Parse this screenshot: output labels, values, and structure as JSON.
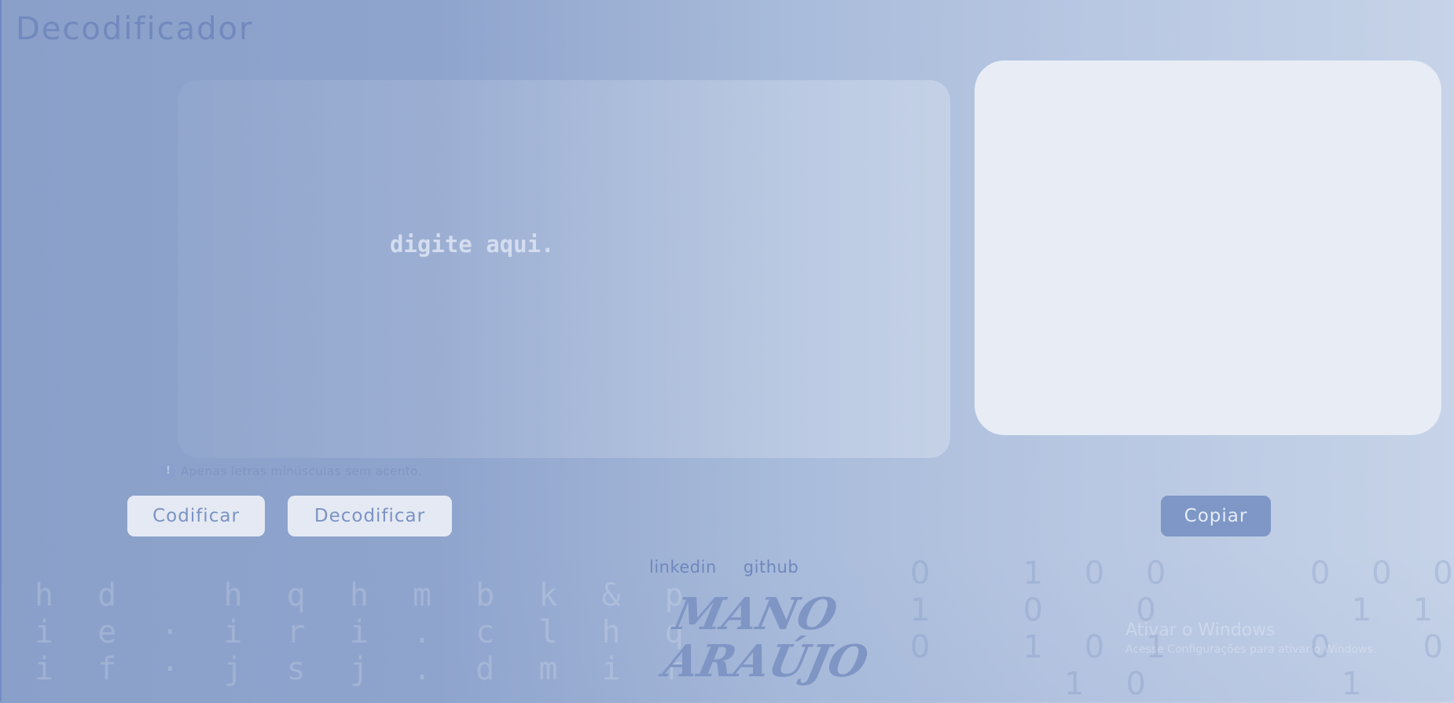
{
  "header": {
    "title": "Decodificador"
  },
  "input": {
    "placeholder": "digite aqui."
  },
  "hint": {
    "icon": "info-icon",
    "text": "Apenas letras minúsculas sem acento."
  },
  "buttons": {
    "encode": "Codificar",
    "decode": "Decodificar",
    "copy": "Copiar"
  },
  "footer": {
    "links": [
      "linkedin",
      "github"
    ],
    "logo_line1": "MANO",
    "logo_line2": "ARAÚJO",
    "bg_letters": "h d   h q h m b k & p\ni e · i r i . c l h q\ni f · j s j . d m i r",
    "bg_binary": "0   1 0 0     0 0 0 0   0 1\n1   0   0       1 1 0 0 1 0\n0   1 0 1     0   0 0     1\n      1 0       1   1 0 1 0"
  },
  "watermark": {
    "title": "Ativar o Windows",
    "subtitle": "Acesse Configurações para ativar o Windows."
  },
  "colors": {
    "accent": "#7e97c6",
    "output_bg": "#e7ecf5",
    "title": "#7189bd"
  }
}
